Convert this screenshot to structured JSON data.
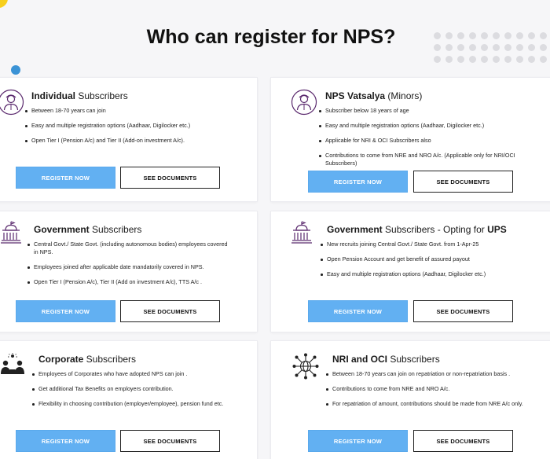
{
  "title": "Who can register for NPS?",
  "buttons": {
    "register": "REGISTER NOW",
    "documents": "SEE DOCUMENTS"
  },
  "cards": [
    {
      "title_bold": "Individual",
      "title_rest": " Subscribers",
      "icon": "person-icon",
      "items": [
        "Between 18-70 years can join",
        "Easy and multiple registration options (Aadhaar, Digilocker etc.)",
        "Open Tier I (Pension A/c) and Tier II (Add-on investment A/c)."
      ]
    },
    {
      "title_bold": "NPS Vatsalya",
      "title_rest": " (Minors)",
      "icon": "person-icon",
      "items": [
        "Subscriber below 18 years of age",
        "Easy and multiple registration options (Aadhaar, Digilocker etc.)",
        "Applicable for NRI & OCI Subscribers also",
        "Contributions to come from NRE and NRO A/c. (Applicable only for NRI/OCI Subscribers)"
      ]
    },
    {
      "title_bold": "Government",
      "title_rest": " Subscribers",
      "icon": "government-building-icon",
      "items": [
        "Central Govt./ State Govt. (including autonomous bodies) employees covered in NPS.",
        "Employees joined after applicable date mandatorily covered in NPS.",
        "Open Tier I (Pension A/c), Tier II (Add on investment A/c), TTS A/c ."
      ]
    },
    {
      "title_bold": "Government",
      "title_rest": " Subscribers - Opting for ",
      "title_bold2": "UPS",
      "icon": "government-building-icon",
      "items": [
        "New recruits joining Central Govt./ State Govt. from 1-Apr-25",
        "Open Pension Account and get benefit of assured payout",
        "Easy and multiple registration options (Aadhaar, Digilocker etc.)"
      ]
    },
    {
      "title_bold": "Corporate",
      "title_rest": " Subscribers",
      "icon": "corporate-team-icon",
      "items": [
        "Employees of Corporates who have adopted NPS can join .",
        "Get additional Tax Benefits on employers contribution.",
        "Flexibility in choosing contribution (employer/employee), pension fund etc."
      ]
    },
    {
      "title_bold": "NRI and OCI",
      "title_rest": " Subscribers",
      "icon": "global-network-icon",
      "items": [
        "Between 18-70 years can join on repatriation or non-repatriation basis .",
        "Contributions to come from NRE and NRO A/c.",
        "For repatriation of amount, contributions should be made from NRE A/c only."
      ]
    }
  ]
}
